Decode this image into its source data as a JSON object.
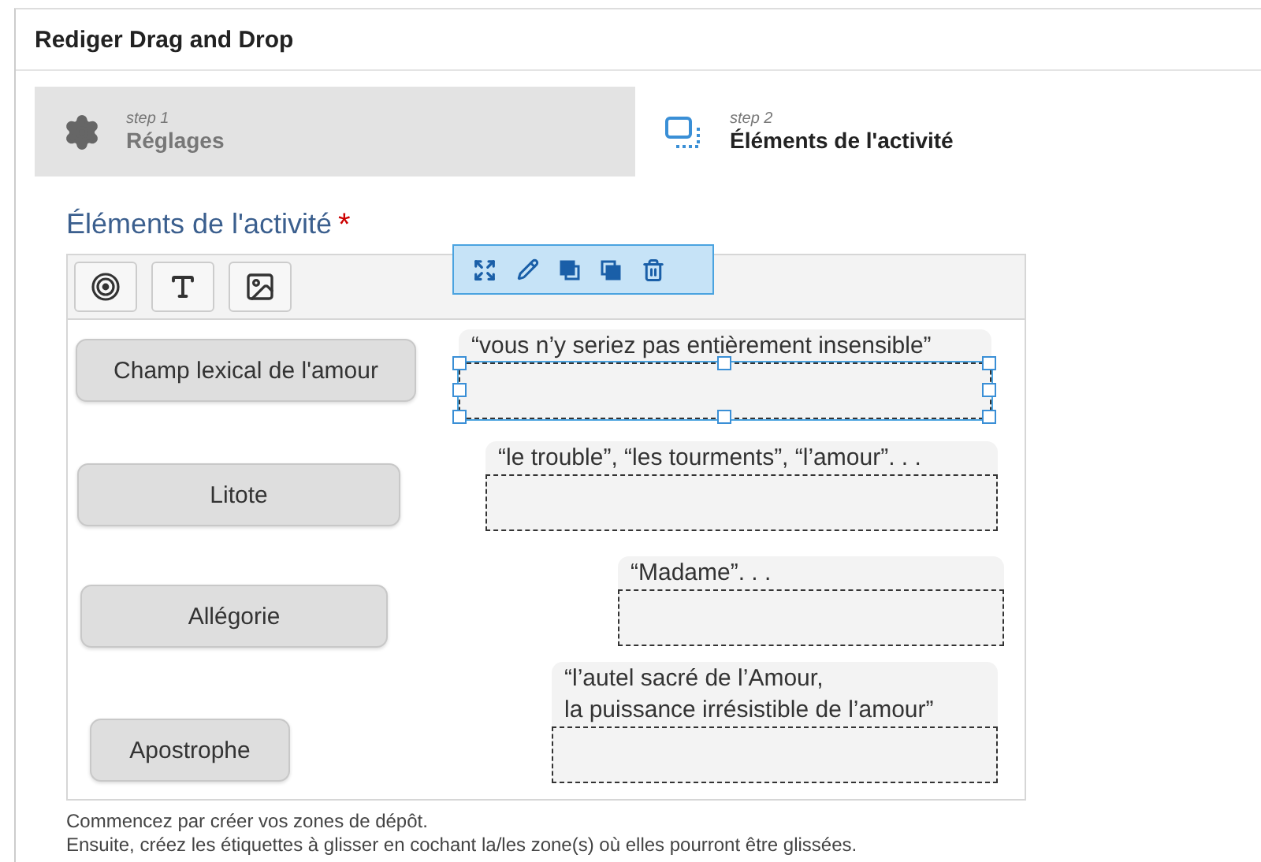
{
  "window": {
    "title": "Rediger Drag and Drop"
  },
  "steps": [
    {
      "label": "step 1",
      "title": "Réglages",
      "selected": false,
      "kind": "settings"
    },
    {
      "label": "step 2",
      "title": "Éléments de l'activité",
      "selected": true,
      "kind": "elements"
    }
  ],
  "section": {
    "title": "Éléments de l'activité",
    "required_mark": "*"
  },
  "labels": [
    "Champ lexical de l'amour",
    "Litote",
    "Allégorie",
    "Apostrophe"
  ],
  "drop_zones": [
    {
      "caption": "“vous n’y seriez pas entièrement insensible”",
      "selected": true
    },
    {
      "caption": "“le trouble”, “les tourments”, “l’amour”. . .",
      "selected": false
    },
    {
      "caption": "“Madame”. . .",
      "selected": false
    },
    {
      "caption": "“l’autel sacré de l’Amour,\nla puissance irrésistible de l’amour”",
      "selected": false
    }
  ],
  "instructions": [
    "Commencez par créer vos zones de dépôt.",
    "Ensuite, créez les étiquettes à glisser en cochant la/les zone(s) où elles pourront être glissées."
  ]
}
